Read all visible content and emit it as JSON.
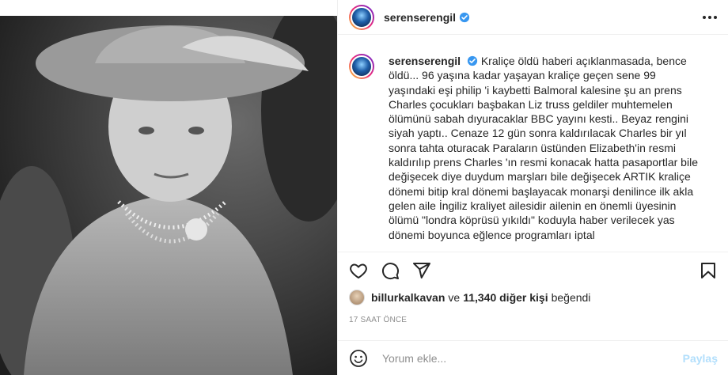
{
  "post": {
    "username": "serenserengil",
    "caption": "Kraliçe öldü haberi açıklanmasada, bence öldü... 96 yaşına kadar yaşayan kraliçe geçen sene 99 yaşındaki eşi philip 'i kaybetti Balmoral kalesine şu an prens Charles çocukları başbakan Liz truss geldiler muhtemelen ölümünü sabah dıyuracaklar BBC yayını kesti.. Beyaz rengini siyah yaptı.. Cenaze 12 gün sonra kaldırılacak Charles bir yıl sonra tahta oturacak Paraların üstünden Elizabeth'in resmi kaldırılıp prens Charles 'ın resmi konacak hatta pasaportlar bile değişecek diye duydum marşları bile değişecek ARTIK kraliçe dönemi bitip kral dönemi başlayacak monarşi denilince ilk akla gelen aile İngiliz kraliyet ailesidir ailenin en önemli üyesinin ölümü \"londra köprüsü yıkıldı\" koduyla haber verilecek yas dönemi boyunca eğlence programları iptal"
  },
  "likes": {
    "liker": "billurkalkavan",
    "connector": "ve",
    "others": "11,340 diğer kişi",
    "suffix": "beğendi"
  },
  "timestamp": "17 SAAT ÖNCE",
  "comment": {
    "placeholder": "Yorum ekle...",
    "post_label": "Paylaş"
  },
  "colors": {
    "verified": "#3897f0",
    "post_button_disabled": "#b2dffc",
    "meta_text": "#8e8e8e"
  },
  "icons": [
    "verified-icon",
    "more-icon",
    "heart-icon",
    "comment-icon",
    "share-icon",
    "bookmark-icon",
    "emoji-icon"
  ]
}
